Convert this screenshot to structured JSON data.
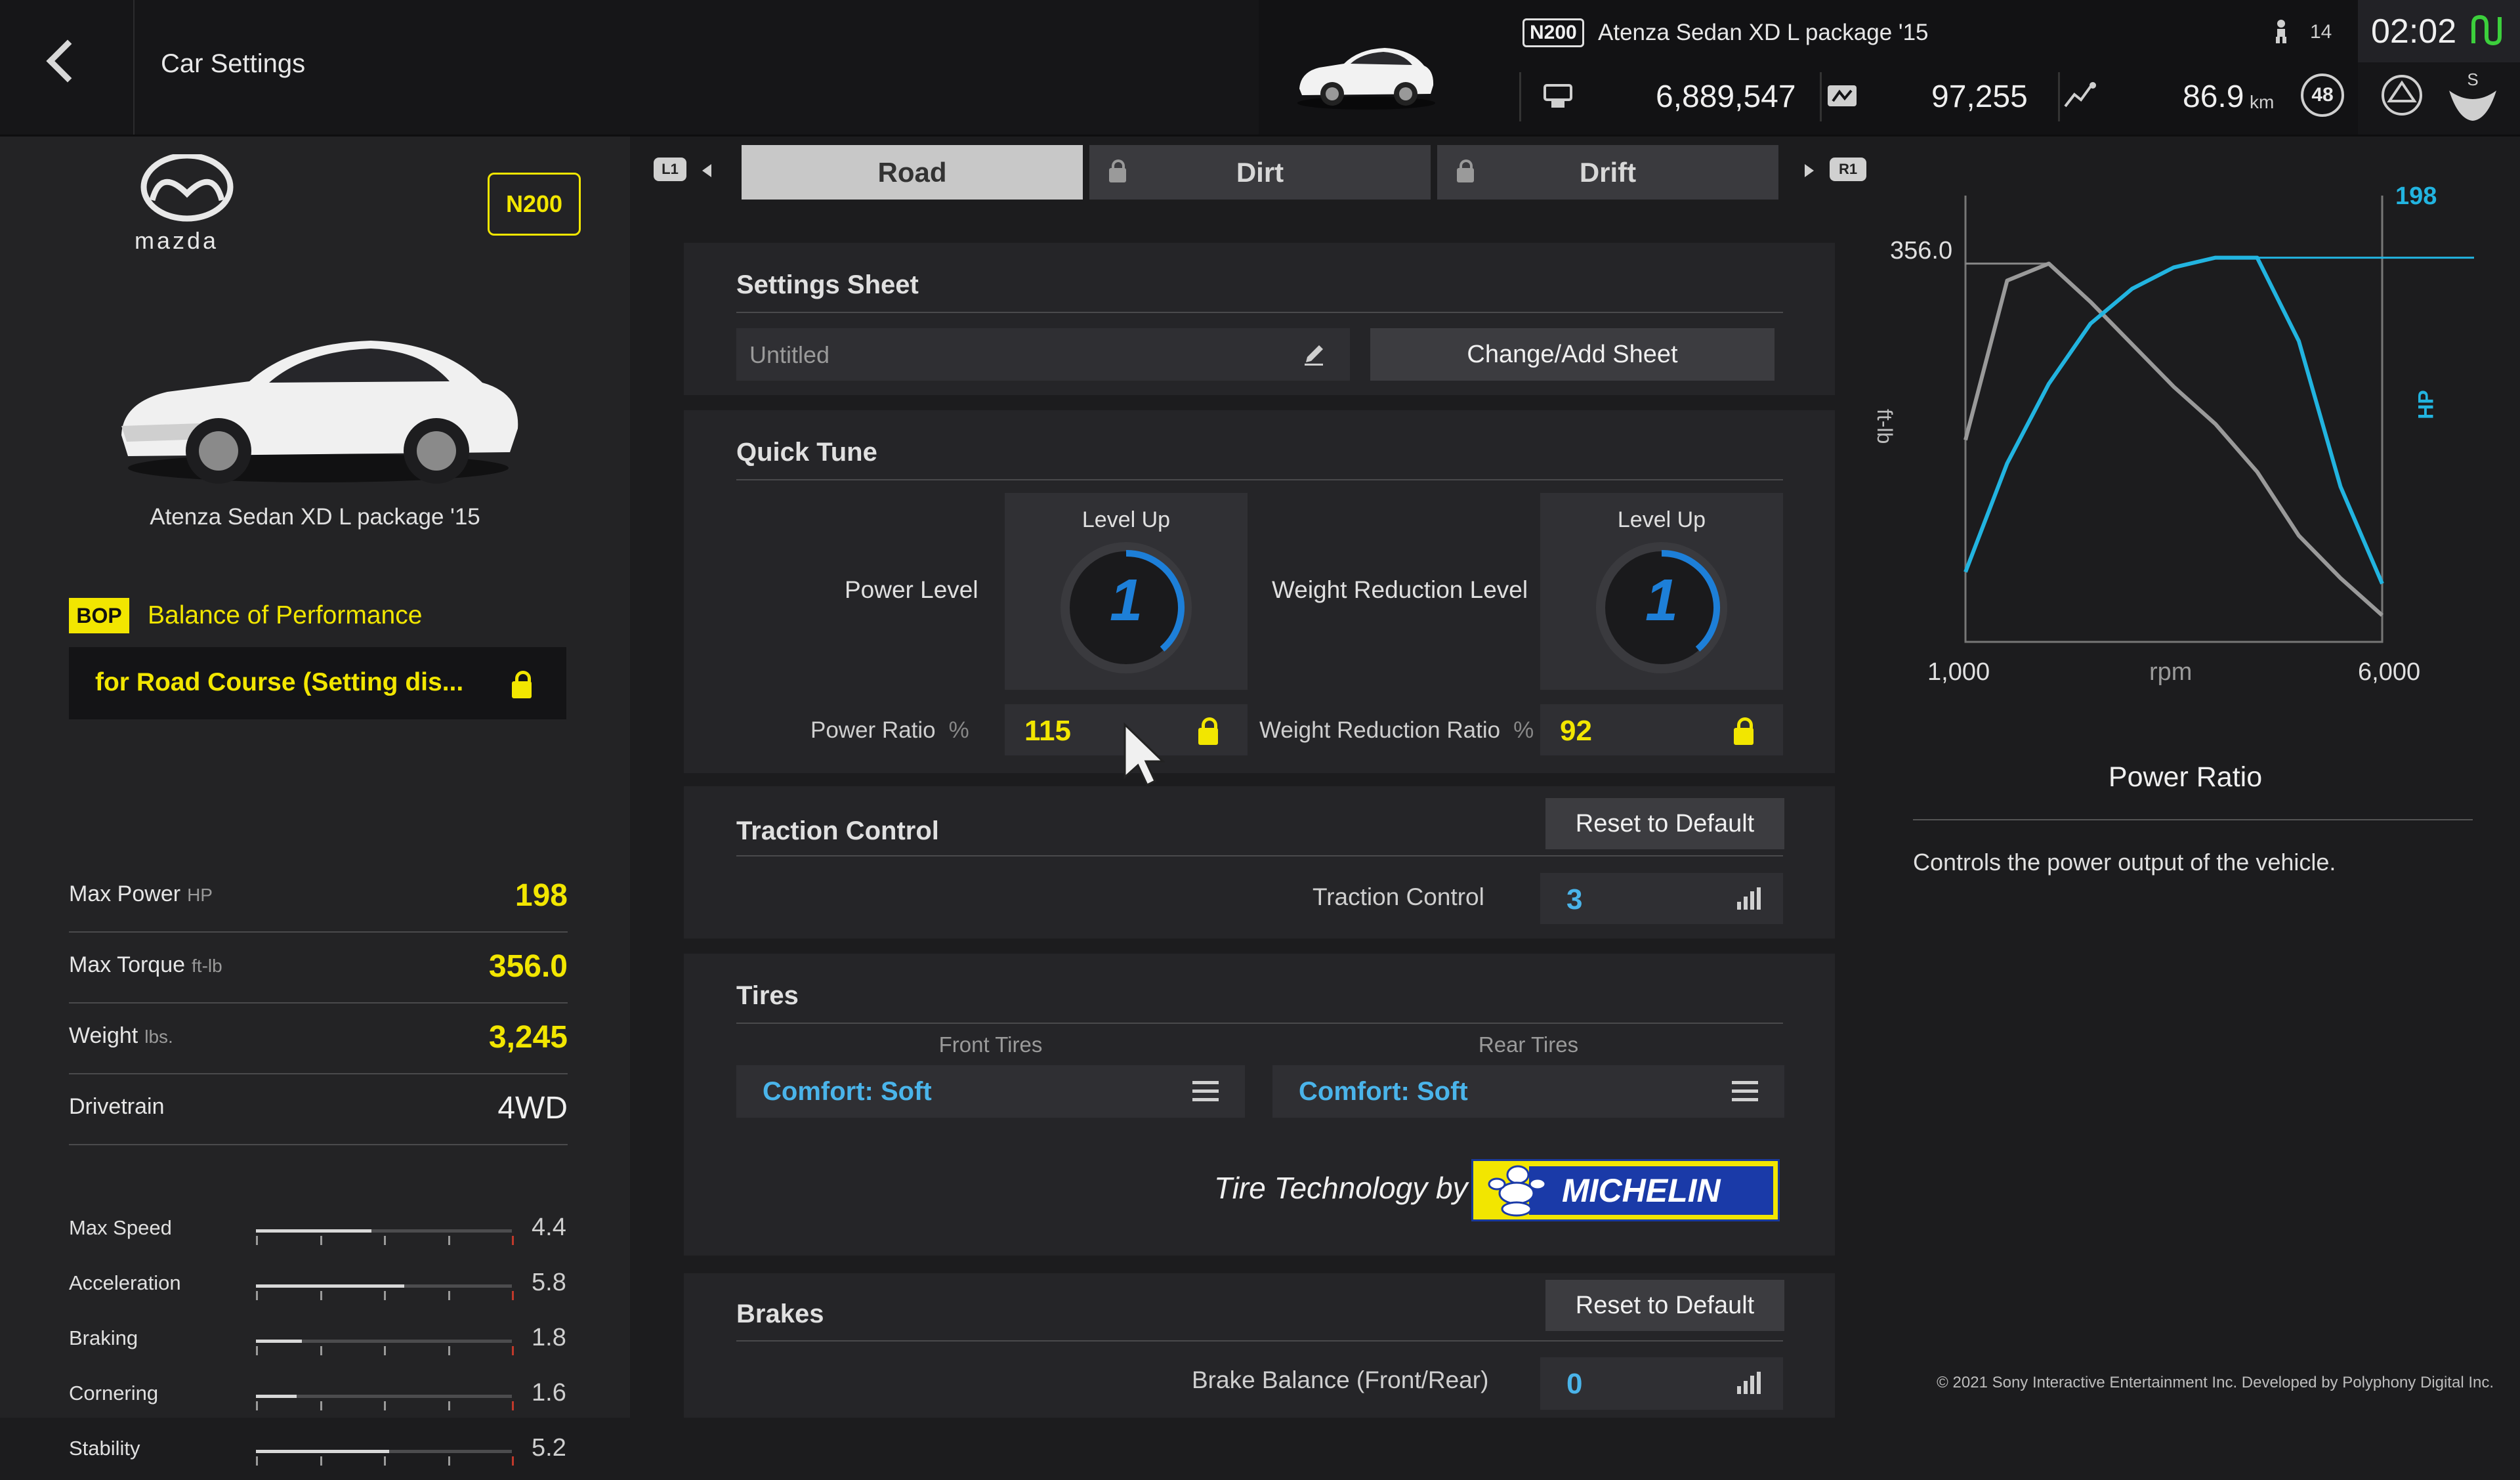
{
  "header": {
    "title": "Car Settings",
    "car_class": "N200",
    "car_name": "Atenza Sedan XD L package '15",
    "credits": "6,889,547",
    "mileage_points": "97,255",
    "distance": "86.9",
    "distance_unit": "km",
    "level": "48",
    "friends_count": "14",
    "time": "02:02"
  },
  "left": {
    "brand": "mazda",
    "class_badge": "N200",
    "car_name": "Atenza Sedan XD L package '15",
    "bop_badge": "BOP",
    "bop_title": "Balance of Performance",
    "bop_setting": "for Road Course (Setting dis...",
    "specs": [
      {
        "label": "Max Power",
        "unit": "HP",
        "value": "198"
      },
      {
        "label": "Max Torque",
        "unit": "ft-lb",
        "value": "356.0"
      },
      {
        "label": "Weight",
        "unit": "lbs.",
        "value": "3,245"
      },
      {
        "label": "Drivetrain",
        "unit": "",
        "value": "4WD"
      }
    ],
    "performance": [
      {
        "label": "Max Speed",
        "value": "4.4",
        "fill": 0.45
      },
      {
        "label": "Acceleration",
        "value": "5.8",
        "fill": 0.58
      },
      {
        "label": "Braking",
        "value": "1.8",
        "fill": 0.18
      },
      {
        "label": "Cornering",
        "value": "1.6",
        "fill": 0.16
      },
      {
        "label": "Stability",
        "value": "5.2",
        "fill": 0.52
      }
    ]
  },
  "tabs": {
    "left_shoulder": "L1",
    "right_shoulder": "R1",
    "items": [
      {
        "label": "Road",
        "active": true,
        "locked": false
      },
      {
        "label": "Dirt",
        "active": false,
        "locked": true
      },
      {
        "label": "Drift",
        "active": false,
        "locked": true
      }
    ]
  },
  "settings_sheet": {
    "title": "Settings Sheet",
    "sheet_name": "Untitled",
    "change_button": "Change/Add Sheet"
  },
  "quick_tune": {
    "title": "Quick Tune",
    "level_up_label": "Level Up",
    "power_level_label": "Power Level",
    "power_level_value": "1",
    "weight_level_label": "Weight Reduction Level",
    "weight_level_value": "1",
    "power_ratio_label": "Power Ratio",
    "power_ratio_unit": "%",
    "power_ratio_value": "115",
    "weight_ratio_label": "Weight Reduction Ratio",
    "weight_ratio_unit": "%",
    "weight_ratio_value": "92"
  },
  "traction_control": {
    "title": "Traction Control",
    "reset_button": "Reset to Default",
    "field_label": "Traction Control",
    "value": "3"
  },
  "tires": {
    "title": "Tires",
    "front_label": "Front Tires",
    "front_value": "Comfort: Soft",
    "rear_label": "Rear Tires",
    "rear_value": "Comfort: Soft",
    "tech_by": "Tire Technology by",
    "brand_logo": "MICHELIN"
  },
  "brakes": {
    "title": "Brakes",
    "reset_button": "Reset to Default",
    "field_label": "Brake Balance (Front/Rear)",
    "value": "0"
  },
  "chart": {
    "torque_label": "356.0",
    "power_label": "198",
    "left_axis": "ft-lb",
    "right_axis": "HP",
    "x_min": "1,000",
    "x_label": "rpm",
    "x_max": "6,000"
  },
  "chart_data": {
    "type": "line",
    "x": [
      1000,
      1500,
      2000,
      2500,
      3000,
      3500,
      4000,
      4500,
      5000,
      5500,
      6000
    ],
    "series": [
      {
        "name": "ft-lb",
        "color": "#9a9a9a",
        "axis": "left",
        "values": [
          190,
          340,
          356,
          320,
          280,
          240,
          205,
          160,
          100,
          60,
          25
        ]
      },
      {
        "name": "HP",
        "color": "#22b4e0",
        "axis": "right",
        "values": [
          36,
          92,
          133,
          164,
          182,
          193,
          198,
          198,
          155,
          80,
          30
        ]
      }
    ],
    "xlim": [
      1000,
      6000
    ],
    "ylim_left": [
      0,
      420
    ],
    "ylim_right": [
      0,
      230
    ]
  },
  "description": {
    "title": "Power Ratio",
    "text": "Controls the power output of the vehicle."
  },
  "footer": {
    "copyright": "© 2021 Sony Interactive Entertainment Inc. Developed by Polyphony Digital Inc."
  },
  "colors": {
    "accent_yellow": "#f2e600",
    "accent_blue": "#22b4e0",
    "value_blue": "#4ab4ea"
  }
}
